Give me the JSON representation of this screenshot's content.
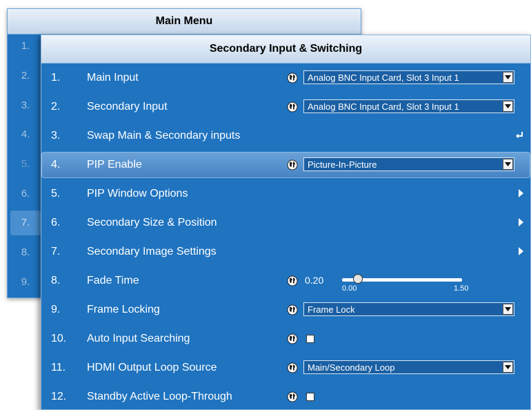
{
  "main_menu": {
    "title": "Main Menu",
    "numbers": [
      "1.",
      "2.",
      "3.",
      "4.",
      "5.",
      "6.",
      "7.",
      "8.",
      "9."
    ]
  },
  "secondary": {
    "title": "Secondary Input & Switching",
    "rows": [
      {
        "num": "1.",
        "label": "Main Input",
        "value": "Analog BNC Input Card, Slot 3 Input 1"
      },
      {
        "num": "2.",
        "label": "Secondary Input",
        "value": "Analog BNC Input Card, Slot 3 Input 1"
      },
      {
        "num": "3.",
        "label": "Swap Main & Secondary inputs"
      },
      {
        "num": "4.",
        "label": "PIP Enable",
        "value": "Picture-In-Picture"
      },
      {
        "num": "5.",
        "label": "PIP Window Options"
      },
      {
        "num": "6.",
        "label": "Secondary Size & Position"
      },
      {
        "num": "7.",
        "label": "Secondary Image Settings"
      },
      {
        "num": "8.",
        "label": "Fade Time",
        "value": "0.20",
        "min": "0.00",
        "max": "1.50"
      },
      {
        "num": "9.",
        "label": "Frame Locking",
        "value": "Frame Lock"
      },
      {
        "num": "10.",
        "label": "Auto Input Searching",
        "checked": false
      },
      {
        "num": "11.",
        "label": "HDMI Output Loop Source",
        "value": "Main/Secondary Loop"
      },
      {
        "num": "12.",
        "label": "Standby Active Loop-Through",
        "checked": false
      }
    ]
  },
  "colors": {
    "panel": "#1f73bf",
    "selected_row": "#5593d0",
    "title_bar": "#dbe7f4"
  },
  "icons": {
    "globe": "globe-icon",
    "enter": "enter-icon",
    "submenu": "chevron-right-icon",
    "dropdown": "dropdown-arrow-icon"
  }
}
